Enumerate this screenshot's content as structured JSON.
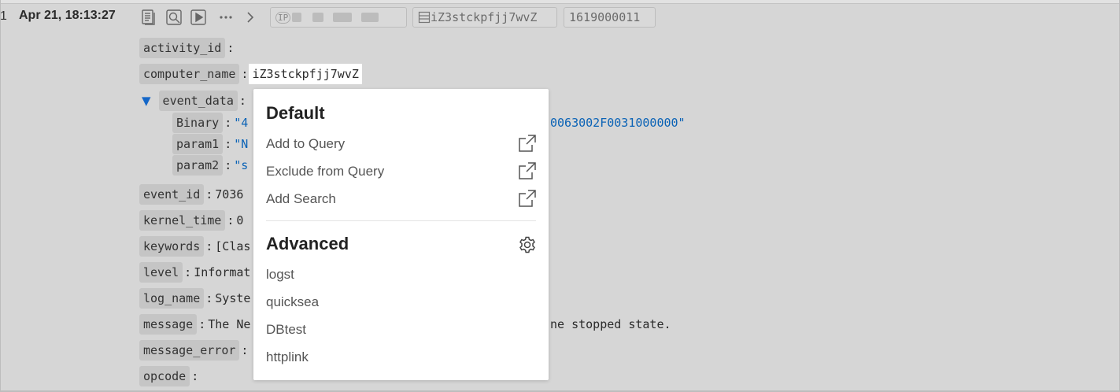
{
  "row": {
    "index": "1",
    "timestamp": "Apr 21, 18:13:27",
    "tags": {
      "ip_prefix": "IP",
      "host": "iZ3stckpfjj7wvZ",
      "id": "1619000011"
    }
  },
  "toolbar_icons": [
    "document-icon",
    "search-icon",
    "play-icon",
    "more-icon",
    "chevron-right-icon"
  ],
  "fields": {
    "activity_id": {
      "key": "activity_id",
      "sep": ":",
      "value": ""
    },
    "computer_name": {
      "key": "computer_name",
      "sep": ":",
      "value": "iZ3stckpfjj7wvZ"
    },
    "event_data": {
      "key": "event_data",
      "sep": ":",
      "children": [
        {
          "key": "Binary",
          "sep": ":",
          "value_left": "\"4",
          "value_right": "0063002F0031000000\""
        },
        {
          "key": "param1",
          "sep": ":",
          "value_left": "\"N"
        },
        {
          "key": "param2",
          "sep": ":",
          "value_left": "\"s"
        }
      ]
    },
    "event_id": {
      "key": "event_id",
      "sep": ":",
      "value": "7036"
    },
    "kernel_time": {
      "key": "kernel_time",
      "sep": ":",
      "value": "0"
    },
    "keywords": {
      "key": "keywords",
      "sep": ":",
      "value": "[Clas"
    },
    "level": {
      "key": "level",
      "sep": ":",
      "value": "Informat"
    },
    "log_name": {
      "key": "log_name",
      "sep": ":",
      "value": "Syste"
    },
    "message": {
      "key": "message",
      "sep": ":",
      "value": "The Ne",
      "value_right": "ne stopped state."
    },
    "message_error": {
      "key": "message_error",
      "sep": ":",
      "value": ""
    },
    "opcode": {
      "key": "opcode",
      "sep": ":",
      "value": ""
    }
  },
  "popup": {
    "default_heading": "Default",
    "default_items": [
      "Add to Query",
      "Exclude from Query",
      "Add Search"
    ],
    "advanced_heading": "Advanced",
    "advanced_items": [
      "logst",
      "quicksea",
      "DBtest",
      "httplink"
    ]
  },
  "colors": {
    "background": "#d6d6d6",
    "key_bg": "#c5c5c5",
    "string": "#0b63b6",
    "triangle": "#1567c8",
    "popup_bg": "#ffffff"
  }
}
